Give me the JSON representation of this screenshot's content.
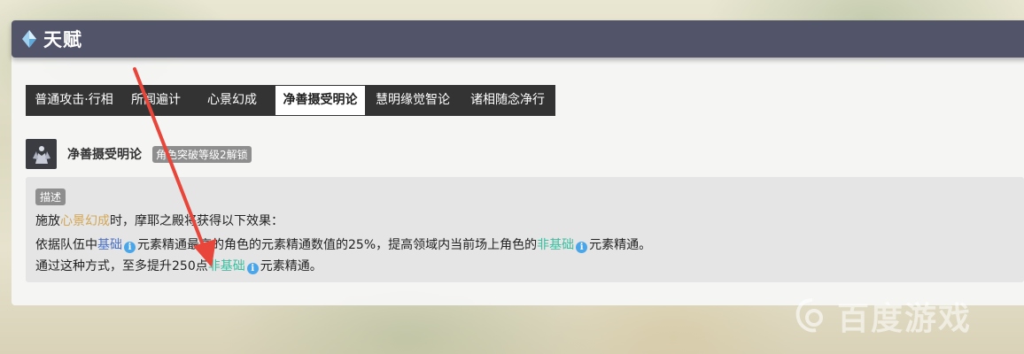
{
  "header": {
    "title": "天赋",
    "icon": "diamond-icon",
    "accent": "#52556a"
  },
  "tabs": [
    {
      "label": "普通攻击·行相",
      "active": false
    },
    {
      "label": "所闻遍计",
      "active": false
    },
    {
      "label": "心景幻成",
      "active": false
    },
    {
      "label": "净善摄受明论",
      "active": true
    },
    {
      "label": "慧明缘觉智论",
      "active": false
    },
    {
      "label": "诸相随念净行",
      "active": false
    }
  ],
  "talent": {
    "icon": "talent-icon",
    "name": "净善摄受明论",
    "unlock": "角色突破等级2解锁"
  },
  "description": {
    "badge": "描述",
    "line1": {
      "a": "施放",
      "b": "心景幻成",
      "c": "时，摩耶之殿将获得以下效果："
    },
    "line2": {
      "a": "依据队伍中",
      "b": "基础",
      "c": "元素精通最高的角色的元素精通数值的25%，提高领域内当前场上角色的",
      "d": "非基础",
      "e": "元素精通。"
    },
    "line3": {
      "a": "通过这种方式，至多提升250点",
      "b": "非基础",
      "c": "元素精通。"
    },
    "info_symbol": "i"
  },
  "colors": {
    "gold": "#d3a655",
    "blue": "#4a71c8",
    "green": "#3bbfa0",
    "arrow": "#e8463a"
  },
  "watermark": {
    "text": "百度游戏"
  }
}
